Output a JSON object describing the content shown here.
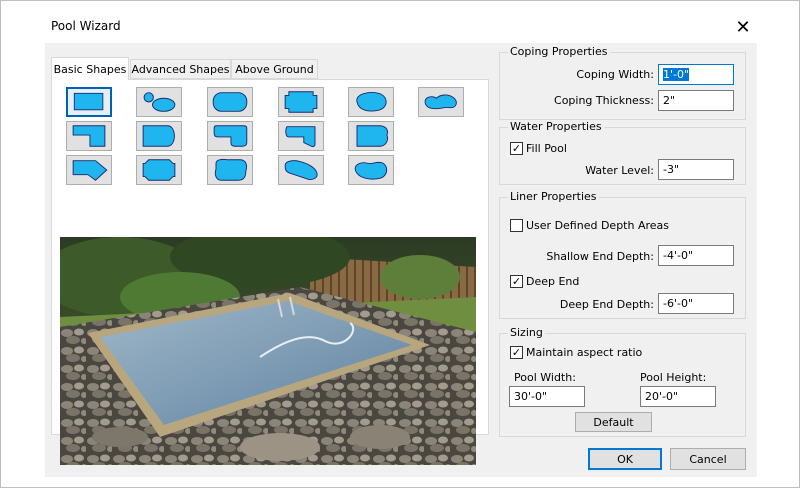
{
  "window": {
    "title": "Pool Wizard"
  },
  "tabs": [
    {
      "label": "Basic Shapes"
    },
    {
      "label": "Advanced Shapes"
    },
    {
      "label": "Above Ground"
    }
  ],
  "shapes": [
    {
      "name": "rectangle",
      "selected": true
    },
    {
      "name": "hot-tub-pair"
    },
    {
      "name": "rounded-rectangle"
    },
    {
      "name": "notched-rectangle"
    },
    {
      "name": "kidney"
    },
    {
      "name": "blob"
    },
    {
      "name": "l-shape"
    },
    {
      "name": "roman-end"
    },
    {
      "name": "l-rounded"
    },
    {
      "name": "lazy-l"
    },
    {
      "name": "grecian"
    },
    {
      "name": "arrow"
    },
    {
      "name": "octagon"
    },
    {
      "name": "freeform-rounded"
    },
    {
      "name": "freeform-lagoon"
    },
    {
      "name": "kidney-alt"
    }
  ],
  "coping": {
    "title": "Coping Properties",
    "width_label": "Coping Width:",
    "width_value": "1'-0\"",
    "thickness_label": "Coping Thickness:",
    "thickness_value": "2\""
  },
  "water": {
    "title": "Water Properties",
    "fill_pool_label": "Fill Pool",
    "fill_pool_checked": true,
    "level_label": "Water Level:",
    "level_value": "-3\""
  },
  "liner": {
    "title": "Liner Properties",
    "user_defined_label": "User Defined Depth Areas",
    "user_defined_checked": false,
    "shallow_label": "Shallow End Depth:",
    "shallow_value": "-4'-0\"",
    "deep_end_label": "Deep End",
    "deep_end_checked": true,
    "deep_label": "Deep End Depth:",
    "deep_value": "-6'-0\""
  },
  "sizing": {
    "title": "Sizing",
    "aspect_label": "Maintain aspect ratio",
    "aspect_checked": true,
    "width_label": "Pool Width:",
    "width_value": "30'-0\"",
    "height_label": "Pool Height:",
    "height_value": "20'-0\"",
    "default_label": "Default"
  },
  "footer": {
    "ok_label": "OK",
    "cancel_label": "Cancel"
  },
  "colors": {
    "pool_blue": "#1fb5ee",
    "pool_outline": "#1b2a6b",
    "accent": "#0078d7"
  }
}
